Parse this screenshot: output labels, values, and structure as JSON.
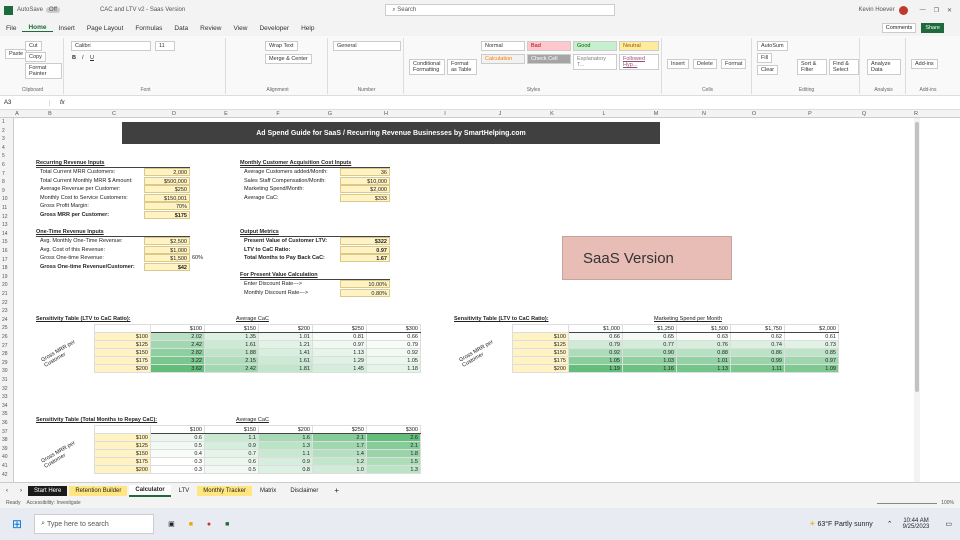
{
  "titlebar": {
    "autosave": "AutoSave",
    "autosave_state": "Off",
    "filename": "CAC and LTV v2 - Saas Version",
    "search": "Search",
    "user": "Kevin Hoever"
  },
  "menu": [
    "File",
    "Home",
    "Insert",
    "Page Layout",
    "Formulas",
    "Data",
    "Review",
    "View",
    "Developer",
    "Help"
  ],
  "ribbon": {
    "comments": "Comments",
    "share": "Share",
    "font_name": "Calibri",
    "font_size": "11",
    "number_format": "General",
    "styles": [
      "Normal",
      "Bad",
      "Good",
      "Neutral",
      "Calculation",
      "Check Cell",
      "Explanatory T...",
      "Followed Hyp..."
    ],
    "groups": [
      "Clipboard",
      "Font",
      "Alignment",
      "Number",
      "Styles",
      "Cells",
      "Editing",
      "Analysis",
      "Add-ins"
    ],
    "buttons": {
      "cut": "Cut",
      "copy": "Copy",
      "format_painter": "Format Painter",
      "paste": "Paste",
      "wrap": "Wrap Text",
      "merge": "Merge & Center",
      "cond": "Conditional Formatting",
      "fmt_table": "Format as Table",
      "insert": "Insert",
      "delete": "Delete",
      "format": "Format",
      "autosum": "AutoSum",
      "fill": "Fill",
      "clear": "Clear",
      "sort": "Sort & Filter",
      "find": "Find & Select",
      "analyze": "Analyze Data",
      "addins": "Add-ins"
    }
  },
  "formula": {
    "namebox": "A3",
    "fx": "fx"
  },
  "columns": [
    "A",
    "B",
    "C",
    "D",
    "E",
    "F",
    "G",
    "H",
    "I",
    "J",
    "K",
    "L",
    "M",
    "N",
    "O",
    "P",
    "Q",
    "R",
    "S"
  ],
  "rows": [
    "1",
    "2",
    "3",
    "4",
    "5",
    "6",
    "7",
    "8",
    "9",
    "10",
    "11",
    "12",
    "13",
    "14",
    "15",
    "16",
    "17",
    "18",
    "19",
    "20",
    "21",
    "22",
    "23",
    "24",
    "25",
    "26",
    "27",
    "28",
    "29",
    "30",
    "31",
    "32",
    "33",
    "34",
    "35",
    "36",
    "37",
    "38",
    "39",
    "40",
    "41",
    "42"
  ],
  "sheet_title": "Ad Spend Guide for SaaS / Recurring Revenue Businesses by SmartHelping.com",
  "saas_label": "SaaS Version",
  "rev_inputs": {
    "title": "Recurring Revenue Inputs",
    "rows": [
      {
        "label": "Total Current MRR Customers:",
        "value": "2,000"
      },
      {
        "label": "Total Current Monthly MRR $ Amount:",
        "value": "$500,000"
      },
      {
        "label": "Average Revenue per Customer:",
        "value": "$250"
      },
      {
        "label": "Monthly Cost to Service Customers:",
        "value": "$150,001"
      },
      {
        "label": "Gross Profit Margin:",
        "value": "70%"
      },
      {
        "label": "Gross MRR per Customer:",
        "value": "$175"
      }
    ]
  },
  "cac_inputs": {
    "title": "Monthly Customer Acquisition Cost Inputs",
    "rows": [
      {
        "label": "Average Customers added/Month:",
        "value": "36"
      },
      {
        "label": "Sales Staff Compensation/Month:",
        "value": "$10,000"
      },
      {
        "label": "Marketing Spend/Month:",
        "value": "$2,000"
      },
      {
        "label": "Average CaC:",
        "value": "$333"
      }
    ]
  },
  "onetime": {
    "title": "One-Time Revenue Inputs",
    "rows": [
      {
        "label": "Avg. Monthly One-Time Revenue:",
        "value": "$2,500"
      },
      {
        "label": "Avg. Cost of this Revenue:",
        "value": "$1,000"
      },
      {
        "label": "Gross One-time Revenue:",
        "value": "$1,500",
        "extra": "60%"
      },
      {
        "label": "Gross One-time Revenue/Customer:",
        "value": "$42"
      }
    ]
  },
  "output": {
    "title": "Output Metrics",
    "rows": [
      {
        "label": "Present Value of Customer LTV:",
        "value": "$322"
      },
      {
        "label": "LTV to CaC Ratio:",
        "value": "0.97"
      },
      {
        "label": "Total Months to Pay Back CaC:",
        "value": "1.67"
      }
    ]
  },
  "pv": {
    "title": "For Present Value Calculation",
    "rows": [
      {
        "label": "Enter Discount Rate--->",
        "value": "10.00%"
      },
      {
        "label": "Monthly Discount Rate--->",
        "value": "0.80%"
      }
    ]
  },
  "sens1": {
    "title": "Sensitivity Table (LTV to CaC Ratio):",
    "col_title": "Average CaC",
    "row_title": "Gross MRR per Customer",
    "cols": [
      "$100",
      "$150",
      "$200",
      "$250",
      "$300"
    ],
    "rows": [
      "$100",
      "$125",
      "$150",
      "$175",
      "$200"
    ],
    "data": [
      [
        "2.02",
        "1.35",
        "1.01",
        "0.81",
        "0.66"
      ],
      [
        "2.42",
        "1.61",
        "1.21",
        "0.97",
        "0.79"
      ],
      [
        "2.82",
        "1.88",
        "1.41",
        "1.13",
        "0.92"
      ],
      [
        "3.22",
        "2.15",
        "1.61",
        "1.29",
        "1.05"
      ],
      [
        "3.62",
        "2.42",
        "1.81",
        "1.45",
        "1.18"
      ]
    ]
  },
  "sens2": {
    "title": "Sensitivity Table (LTV to CaC Ratio):",
    "col_title": "Marketing Spend per Month",
    "row_title": "Gross MRR per Customer",
    "cols": [
      "$1,000",
      "$1,250",
      "$1,500",
      "$1,750",
      "$2,000"
    ],
    "rows": [
      "$100",
      "$125",
      "$150",
      "$175",
      "$200"
    ],
    "data": [
      [
        "0.66",
        "0.65",
        "0.63",
        "0.62",
        "0.61"
      ],
      [
        "0.79",
        "0.77",
        "0.76",
        "0.74",
        "0.73"
      ],
      [
        "0.92",
        "0.90",
        "0.88",
        "0.86",
        "0.85"
      ],
      [
        "1.05",
        "1.03",
        "1.01",
        "0.99",
        "0.97"
      ],
      [
        "1.19",
        "1.16",
        "1.13",
        "1.11",
        "1.09"
      ]
    ]
  },
  "sens3": {
    "title": "Sensitivity Table (Total Months to Repay CaC):",
    "col_title": "Average CaC",
    "row_title": "Gross MRR per Customer",
    "cols": [
      "$100",
      "$150",
      "$200",
      "$250",
      "$300"
    ],
    "rows": [
      "$100",
      "$125",
      "$150",
      "$175",
      "$200"
    ],
    "data": [
      [
        "0.6",
        "1.1",
        "1.6",
        "2.1",
        "2.6"
      ],
      [
        "0.5",
        "0.9",
        "1.3",
        "1.7",
        "2.1"
      ],
      [
        "0.4",
        "0.7",
        "1.1",
        "1.4",
        "1.8"
      ],
      [
        "0.3",
        "0.6",
        "0.9",
        "1.2",
        "1.5"
      ],
      [
        "0.3",
        "0.5",
        "0.8",
        "1.0",
        "1.3"
      ]
    ]
  },
  "tabs": [
    "Start Here",
    "Retention Builder",
    "Calculator",
    "LTV",
    "Monthly Tracker",
    "Matrix",
    "Disclaimer"
  ],
  "active_tab": "Calculator",
  "status": {
    "ready": "Ready",
    "access": "Accessibility: Investigate",
    "zoom": "100%"
  },
  "taskbar": {
    "search": "Type here to search",
    "weather": "63°F Partly sunny",
    "time": "10:44 AM",
    "date": "9/25/2023"
  },
  "colors": {
    "green": "#1d6b3b",
    "title_bg": "#404040",
    "saas_bg": "#e8bdb5",
    "input_bg": "#fff3c4"
  }
}
